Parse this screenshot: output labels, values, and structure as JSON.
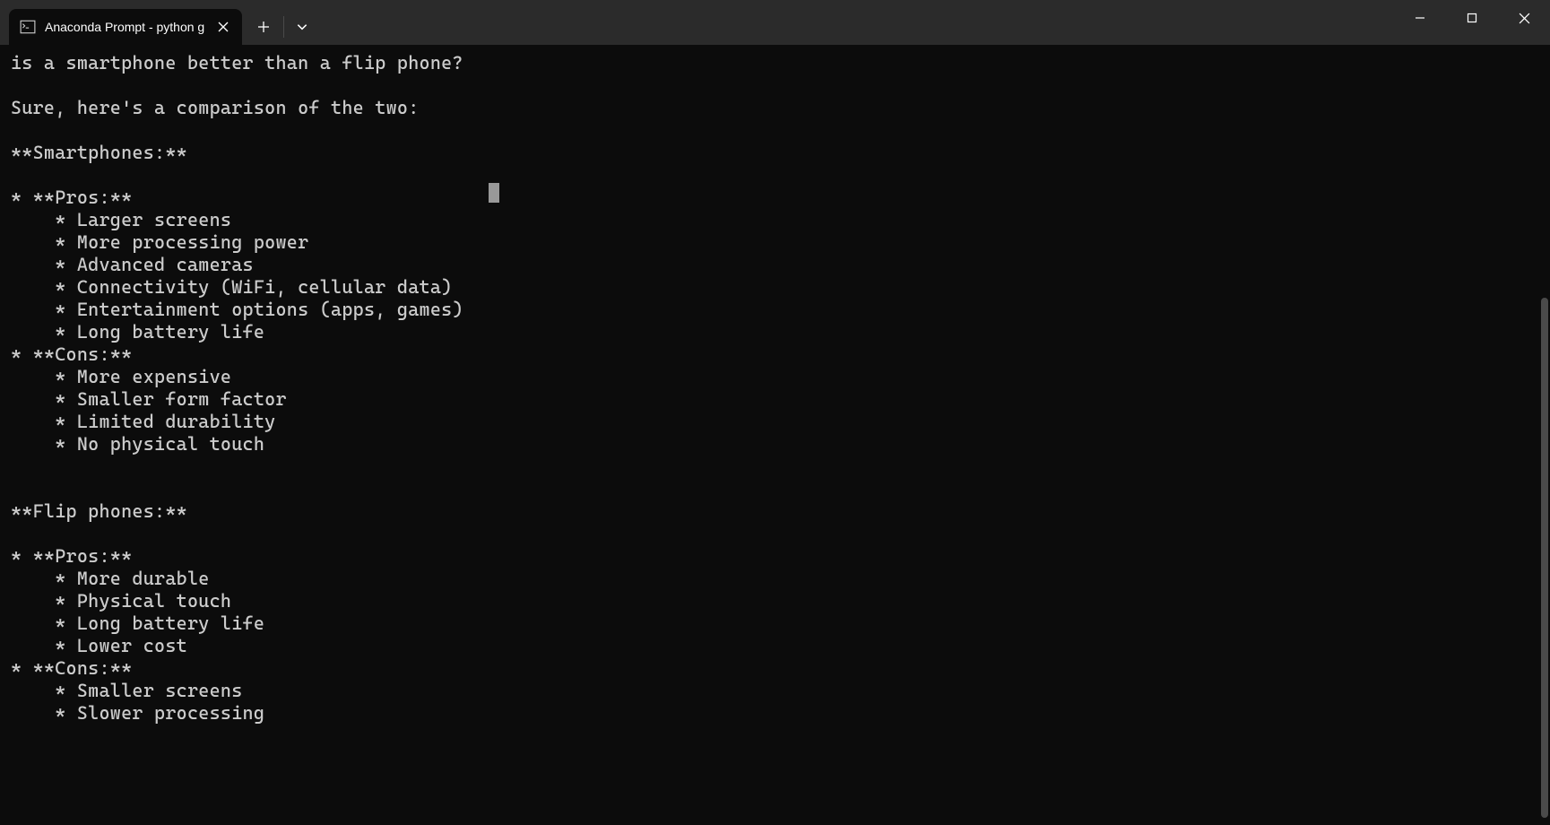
{
  "tab": {
    "title": "Anaconda Prompt - python  g"
  },
  "terminal": {
    "lines": [
      "is a smartphone better than a flip phone?",
      "",
      "Sure, here's a comparison of the two:",
      "",
      "**Smartphones:**",
      "",
      "* **Pros:**",
      "    * Larger screens",
      "    * More processing power",
      "    * Advanced cameras",
      "    * Connectivity (WiFi, cellular data)",
      "    * Entertainment options (apps, games)",
      "    * Long battery life",
      "* **Cons:**",
      "    * More expensive",
      "    * Smaller form factor",
      "    * Limited durability",
      "    * No physical touch",
      "",
      "",
      "**Flip phones:**",
      "",
      "* **Pros:**",
      "    * More durable",
      "    * Physical touch",
      "    * Long battery life",
      "    * Lower cost",
      "* **Cons:**",
      "    * Smaller screens",
      "    * Slower processing"
    ]
  }
}
